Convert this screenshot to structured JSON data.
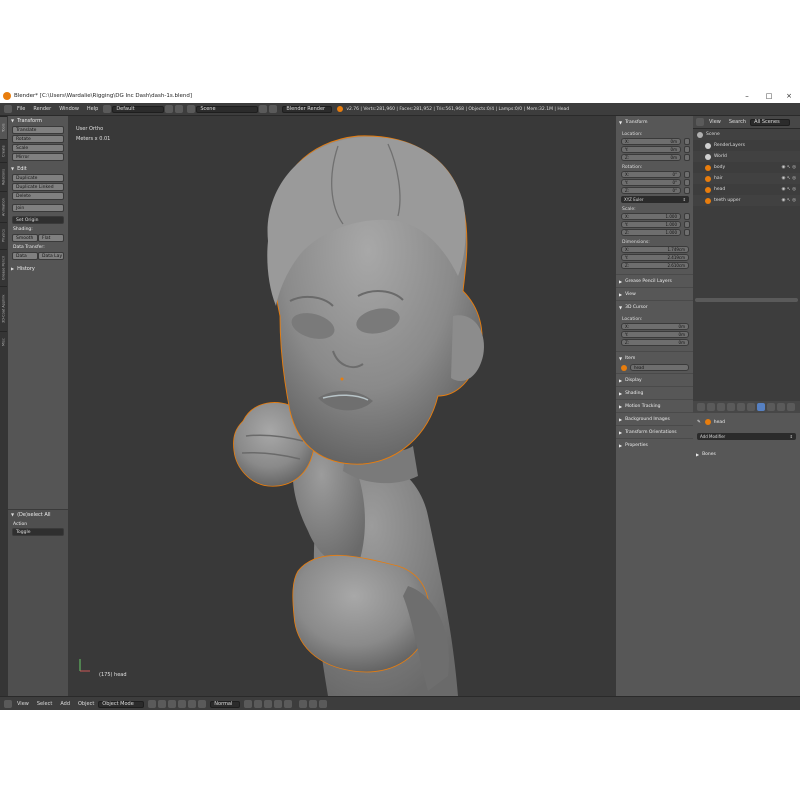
{
  "window": {
    "title": "Blender* [C:\\Users\\Wardalie\\Rigging\\DG Inc Dash\\dash-1s.blend]",
    "min": "–",
    "max": "□",
    "close": "×"
  },
  "info_header": {
    "menus": [
      "File",
      "Render",
      "Window",
      "Help"
    ],
    "layout": "Default",
    "scene": "Scene",
    "engine": "Blender Render",
    "stats": "v2.76 | Verts:281,960 | Faces:281,952 | Tris:561,968 | Objects:0/4 | Lamps:0/0 | Mem:32.1M | Head"
  },
  "left_tabs": [
    "Tools",
    "Create",
    "Relations",
    "Animation",
    "Physics",
    "Grease Pencil",
    "3D-Coat Applink",
    "Misc"
  ],
  "tool_shelf": {
    "transform_header": "Transform",
    "transform_buttons": [
      "Translate",
      "Rotate",
      "Scale",
      "Mirror"
    ],
    "edit_header": "Edit",
    "edit_buttons": [
      "Duplicate",
      "Duplicate Linked",
      "Delete"
    ],
    "join": "Join",
    "set_origin": "Set Origin",
    "shading_label": "Shading:",
    "shading_buttons": [
      "Smooth",
      "Flat"
    ],
    "data_transfer_label": "Data Transfer:",
    "data_transfer_buttons": [
      "Data",
      "Data Lay"
    ],
    "history_header": "History",
    "exclude_header": "(De)select All",
    "action_label": "Action",
    "action_value": "Toggle"
  },
  "viewport": {
    "view_name": "User Ortho",
    "meters": "Meters x 0.01",
    "object_label": "(175) head"
  },
  "n_panel": {
    "transform_header": "Transform",
    "location_label": "Location:",
    "location": [
      {
        "axis": "X:",
        "value": "0m"
      },
      {
        "axis": "Y:",
        "value": "0m"
      },
      {
        "axis": "Z:",
        "value": "0m"
      }
    ],
    "rotation_label": "Rotation:",
    "rotation": [
      {
        "axis": "X:",
        "value": "0°"
      },
      {
        "axis": "Y:",
        "value": "0°"
      },
      {
        "axis": "Z:",
        "value": "0°"
      }
    ],
    "rotation_mode": "XYZ Euler",
    "scale_label": "Scale:",
    "scale": [
      {
        "axis": "X:",
        "value": "1.000"
      },
      {
        "axis": "Y:",
        "value": "1.000"
      },
      {
        "axis": "Z:",
        "value": "1.000"
      }
    ],
    "dimensions_label": "Dimensions:",
    "dimensions": [
      {
        "axis": "X:",
        "value": "1.749cm"
      },
      {
        "axis": "Y:",
        "value": "2.419cm"
      },
      {
        "axis": "Z:",
        "value": "2.610cm"
      }
    ],
    "grease_pencil": "Grease Pencil Layers",
    "view": "View",
    "cursor": "3D Cursor",
    "cursor_location_label": "Location:",
    "cursor_location": [
      {
        "axis": "X:",
        "value": "0m"
      },
      {
        "axis": "Y:",
        "value": "0m"
      },
      {
        "axis": "Z:",
        "value": "0m"
      }
    ],
    "item_header": "Item",
    "item_name": "head",
    "sections": [
      "Display",
      "Shading",
      "Motion Tracking",
      "Background Images",
      "Transform Orientations",
      "Properties"
    ]
  },
  "outliner": {
    "menus": [
      "View",
      "Search"
    ],
    "filter": "All Scenes",
    "rows": [
      {
        "label": "Scene",
        "color": "#b0b0b0",
        "indent": 0
      },
      {
        "label": "RenderLayers",
        "color": "#d0d0d0",
        "indent": 1
      },
      {
        "label": "World",
        "color": "#d0d0d0",
        "indent": 1
      },
      {
        "label": "body",
        "color": "#e87d0d",
        "indent": 1
      },
      {
        "label": "hair",
        "color": "#e87d0d",
        "indent": 1
      },
      {
        "label": "head",
        "color": "#e87d0d",
        "indent": 1
      },
      {
        "label": "teeth upper",
        "color": "#e87d0d",
        "indent": 1
      }
    ]
  },
  "properties": {
    "object_name": "head",
    "add_modifier": "Add Modifier",
    "bones": "Bones"
  },
  "bottom_bar": {
    "menus": [
      "View",
      "Select",
      "Add",
      "Object"
    ],
    "mode": "Object Mode",
    "pivot": "Normal"
  },
  "colors": {
    "accent": "#e87d0d",
    "viewport_bg": "#393939",
    "model": "#8e8e8e"
  }
}
